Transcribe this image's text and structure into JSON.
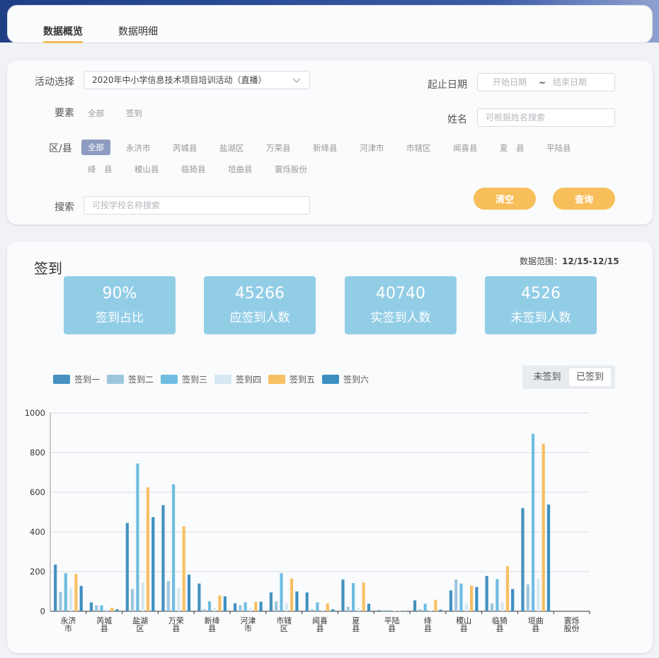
{
  "tabs": [
    {
      "label": "数据概览",
      "active": true
    },
    {
      "label": "数据明细",
      "active": false
    }
  ],
  "filters": {
    "activity_label": "活动选择",
    "activity_value": "2020年中小学信息技术项目培训活动（直播）",
    "date_label": "起止日期",
    "date_start_placeholder": "开始日期",
    "date_sep": "~",
    "date_end_placeholder": "结束日期",
    "element_label": "要素",
    "element_options": [
      "全部",
      "签到"
    ],
    "name_label": "姓名",
    "name_placeholder": "可根据姓名搜索",
    "region_label": "区/县",
    "region_options": [
      "全部",
      "永济市",
      "芮城县",
      "盐湖区",
      "万荣县",
      "新绛县",
      "河津市",
      "市辖区",
      "闻喜县",
      "夏　县",
      "平陆县",
      "绛　县",
      "稷山县",
      "临猗县",
      "垣曲县",
      "寰烁股份"
    ],
    "search_label": "搜索",
    "search_placeholder": "可按学校名称搜索",
    "clear_label": "清空",
    "query_label": "查询"
  },
  "section": {
    "title": "签到",
    "range_label": "数据范围：",
    "range_value": "12/15-12/15"
  },
  "stats": [
    {
      "value": "90%",
      "label": "签到占比"
    },
    {
      "value": "45266",
      "label": "应签到人数"
    },
    {
      "value": "40740",
      "label": "实签到人数"
    },
    {
      "value": "4526",
      "label": "未签到人数"
    }
  ],
  "toggle": {
    "off_label": "未签到",
    "on_label": "已签到",
    "selected": "已签到"
  },
  "colors": {
    "accent": "#f8be5a",
    "stat_bg": "#92cde6",
    "chip": "#8e9bc1"
  },
  "chart_data": {
    "type": "bar",
    "categories": [
      "永济市",
      "芮城县",
      "盐湖区",
      "万荣县",
      "新绛县",
      "河津市",
      "市辖区",
      "闻喜县",
      "夏县",
      "平陆县",
      "绛县",
      "稷山县",
      "临猗县",
      "垣曲县",
      "寰烁股份"
    ],
    "category_lines": [
      [
        "永济",
        "市"
      ],
      [
        "芮城",
        "县"
      ],
      [
        "盐湖",
        "区"
      ],
      [
        "万荣",
        "县"
      ],
      [
        "新绛",
        "县"
      ],
      [
        "河津",
        "市"
      ],
      [
        "市辖",
        "区"
      ],
      [
        "闻喜",
        "县"
      ],
      [
        "夏",
        "县"
      ],
      [
        "平陆",
        "县"
      ],
      [
        "绛",
        "县"
      ],
      [
        "稷山",
        "县"
      ],
      [
        "临猗",
        "县"
      ],
      [
        "垣曲",
        "县"
      ],
      [
        "寰烁",
        "股份"
      ]
    ],
    "series": [
      {
        "name": "签到一",
        "color": "#4591bf",
        "values": [
          235,
          45,
          445,
          535,
          140,
          40,
          95,
          95,
          160,
          5,
          55,
          105,
          178,
          520,
          0
        ]
      },
      {
        "name": "签到二",
        "color": "#9dc6dd",
        "values": [
          98,
          30,
          112,
          152,
          10,
          30,
          50,
          10,
          22,
          5,
          10,
          160,
          40,
          135,
          0
        ]
      },
      {
        "name": "签到三",
        "color": "#70bde1",
        "values": [
          192,
          30,
          745,
          640,
          50,
          45,
          192,
          45,
          142,
          5,
          38,
          140,
          162,
          895,
          0
        ]
      },
      {
        "name": "签到四",
        "color": "#d6e8f2",
        "values": [
          115,
          10,
          145,
          115,
          15,
          15,
          40,
          5,
          15,
          2,
          5,
          40,
          45,
          162,
          0
        ]
      },
      {
        "name": "签到五",
        "color": "#f7c063",
        "values": [
          188,
          18,
          625,
          428,
          80,
          48,
          165,
          40,
          145,
          2,
          58,
          130,
          227,
          845,
          0
        ]
      },
      {
        "name": "签到六",
        "color": "#3d8fc1",
        "values": [
          128,
          10,
          475,
          185,
          75,
          48,
          100,
          10,
          38,
          2,
          8,
          122,
          112,
          538,
          0
        ]
      }
    ],
    "yticks": [
      0,
      200,
      400,
      600,
      800,
      1000
    ],
    "ylim": [
      0,
      1000
    ],
    "grid": true,
    "legend": "top-left"
  }
}
